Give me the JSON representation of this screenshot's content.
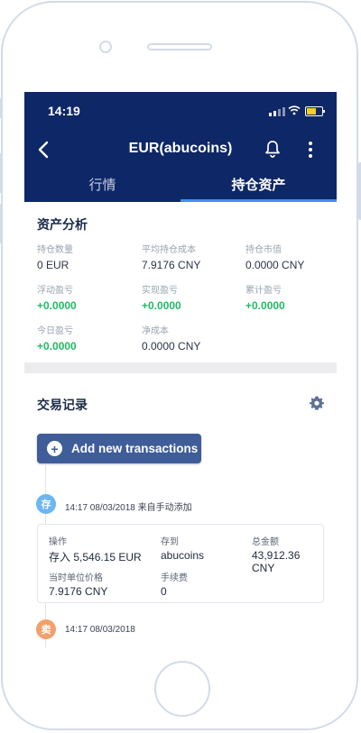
{
  "status_bar": {
    "time": "14:19"
  },
  "nav": {
    "title": "EUR(abucoins)",
    "icons": [
      "back-arrow-icon",
      "bell-icon",
      "more-vertical-icon"
    ]
  },
  "tabs": [
    {
      "label": "行情",
      "active": false
    },
    {
      "label": "持仓资产",
      "active": true
    }
  ],
  "analysis": {
    "title": "资产分析",
    "metrics": [
      {
        "label": "持仓数量",
        "value": "0 EUR"
      },
      {
        "label": "平均持仓成本",
        "value": "7.9176 CNY"
      },
      {
        "label": "持仓市值",
        "value": "0.0000 CNY"
      },
      {
        "label": "浮动盈亏",
        "value": "+0.0000"
      },
      {
        "label": "实现盈亏",
        "value": "+0.0000"
      },
      {
        "label": "累计盈亏",
        "value": "+0.0000"
      },
      {
        "label": "今日盈亏",
        "value": "+0.0000"
      },
      {
        "label": "净成本",
        "value": "0.0000 CNY"
      }
    ]
  },
  "records": {
    "title": "交易记录",
    "add_button": "Add new transactions",
    "events": [
      {
        "badge": "存",
        "text": "14:17 08/03/2018 来自手动添加",
        "color": "#6cb6f2"
      },
      {
        "badge": "卖",
        "text": "14:17 08/03/2018",
        "color": "#f2a06c"
      }
    ],
    "detail": {
      "operation_label": "操作",
      "operation_value": "存入 5,546.15 EUR",
      "deposit_label": "存到",
      "deposit_value": "abucoins",
      "total_label": "总金额",
      "total_value": "43,912.36 CNY",
      "unit_price_label": "当时单位价格",
      "unit_price_value": "7.9176 CNY",
      "fee_label": "手续费",
      "fee_value": "0"
    }
  },
  "colors": {
    "header": "#0e2766",
    "gain": "#1fbb63",
    "button": "#3f5d98",
    "tab_indicator": "#3d8ff5"
  }
}
